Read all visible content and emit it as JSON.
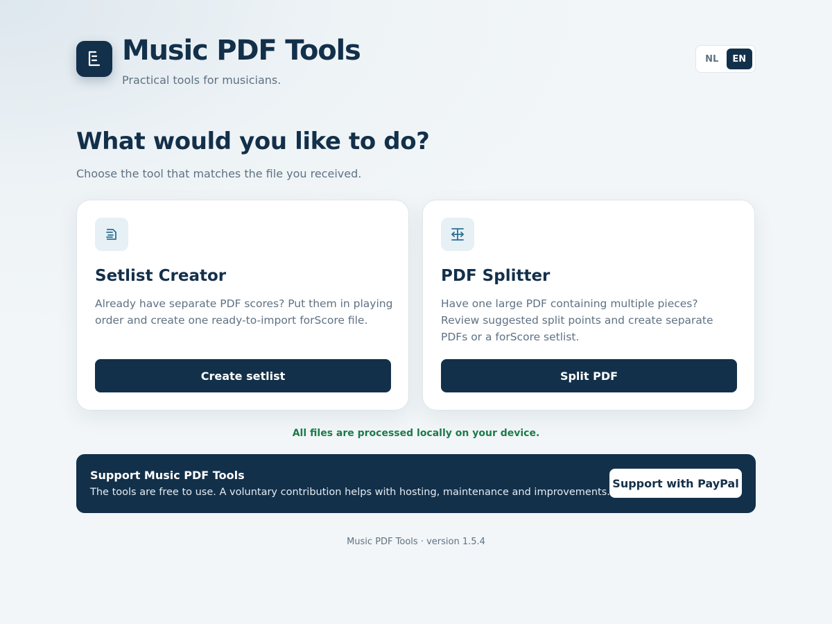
{
  "header": {
    "logo_icon": "setlist-document-icon",
    "title": "Music PDF Tools",
    "subtitle": "Practical tools for musicians.",
    "languages": [
      {
        "label": "NL",
        "active": false
      },
      {
        "label": "EN",
        "active": true
      }
    ]
  },
  "main": {
    "heading": "What would you like to do?",
    "subheading": "Choose the tool that matches the file you received.",
    "tools": [
      {
        "icon": "setlist-icon",
        "title": "Setlist Creator",
        "description": "Already have separate PDF scores? Put them in playing order and create one ready-to-import forScore file.",
        "button_label": "Create setlist"
      },
      {
        "icon": "split-icon",
        "title": "PDF Splitter",
        "description": "Have one large PDF containing multiple pieces? Review suggested split points and create separate PDFs or a forScore setlist.",
        "button_label": "Split PDF"
      }
    ],
    "privacy_note": "All files are processed locally on your device."
  },
  "support": {
    "title": "Support Music PDF Tools",
    "text": "The tools are free to use. A voluntary contribution helps with hosting, maintenance and improvements.",
    "button_label": "Support with PayPal"
  },
  "footer": {
    "text": "Music PDF Tools · version 1.5.4"
  },
  "colors": {
    "primary": "#13304a",
    "accent_green": "#1d7a4a",
    "icon_bg": "#e6f0f5",
    "icon_stroke": "#2a6f94"
  }
}
